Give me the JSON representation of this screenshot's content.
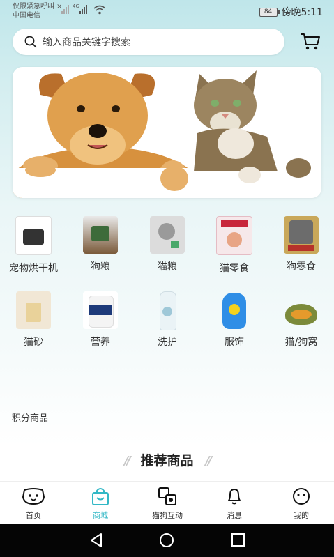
{
  "status_bar": {
    "emergency_text": "仅限紧急呼叫",
    "carrier": "中国电信",
    "network": "4G",
    "battery": "84",
    "time": "傍晚5:11"
  },
  "search": {
    "placeholder": "输入商品关键字搜索"
  },
  "categories": [
    {
      "label": "宠物烘干机",
      "icon": "pet-dryer"
    },
    {
      "label": "狗粮",
      "icon": "dog-food"
    },
    {
      "label": "猫粮",
      "icon": "cat-food"
    },
    {
      "label": "猫零食",
      "icon": "cat-snack"
    },
    {
      "label": "狗零食",
      "icon": "dog-snack"
    },
    {
      "label": "猫砂",
      "icon": "cat-litter"
    },
    {
      "label": "营养",
      "icon": "nutrition"
    },
    {
      "label": "洗护",
      "icon": "wash-care"
    },
    {
      "label": "服饰",
      "icon": "clothing"
    },
    {
      "label": "猫/狗窝",
      "icon": "pet-bed"
    }
  ],
  "points_section": {
    "title": "积分商品"
  },
  "recommend": {
    "title": "推荐商品"
  },
  "tabs": [
    {
      "label": "首页",
      "icon": "dog-face-icon",
      "active": false
    },
    {
      "label": "商城",
      "icon": "shopping-bag-icon",
      "active": true
    },
    {
      "label": "猫狗互动",
      "icon": "interaction-icon",
      "active": false
    },
    {
      "label": "消息",
      "icon": "bell-icon",
      "active": false
    },
    {
      "label": "我的",
      "icon": "smile-icon",
      "active": false
    }
  ],
  "colors": {
    "accent": "#33b8c6",
    "header_bg": "#bfe6ea"
  }
}
